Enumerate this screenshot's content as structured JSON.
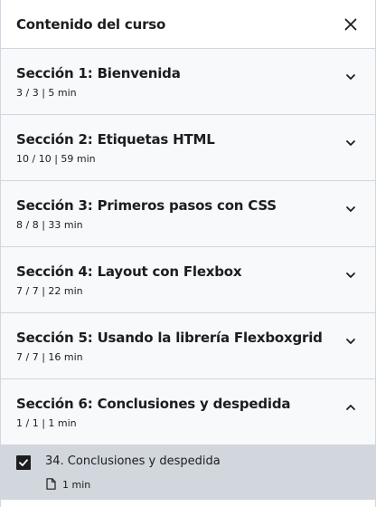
{
  "header": {
    "title": "Contenido del curso",
    "close_icon": "close-icon"
  },
  "sections": [
    {
      "title": "Sección 1: Bienvenida",
      "meta": "3 / 3 | 5 min",
      "expanded": false
    },
    {
      "title": "Sección 2: Etiquetas HTML",
      "meta": "10 / 10 | 59 min",
      "expanded": false
    },
    {
      "title": "Sección 3: Primeros pasos con CSS",
      "meta": "8 / 8 | 33 min",
      "expanded": false
    },
    {
      "title": "Sección 4: Layout con Flexbox",
      "meta": "7 / 7 | 22 min",
      "expanded": false
    },
    {
      "title": "Sección 5: Usando la librería Flexboxgrid",
      "meta": "7 / 7 | 16 min",
      "expanded": false
    },
    {
      "title": "Sección 6: Conclusiones y despedida",
      "meta": "1 / 1 | 1 min",
      "expanded": true
    }
  ],
  "lecture": {
    "title": "34. Conclusiones y despedida",
    "duration": "1 min",
    "completed": true,
    "icon": "file-icon"
  },
  "colors": {
    "section_bg": "#f7f9fa",
    "active_lecture_bg": "#d1d7dc",
    "border": "#d1d7dc",
    "text": "#1c1d1f"
  }
}
